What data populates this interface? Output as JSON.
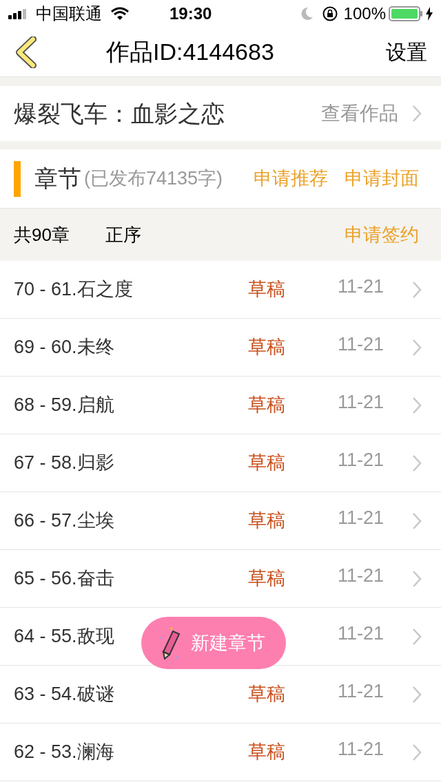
{
  "status_bar": {
    "carrier": "中国联通",
    "time": "19:30",
    "battery": "100%"
  },
  "nav": {
    "title": "作品ID:4144683",
    "action": "设置"
  },
  "book": {
    "title": "爆裂飞车：血影之恋",
    "link": "查看作品"
  },
  "chapters_header": {
    "title": "章节",
    "published": "(已发布74135字)",
    "actions": [
      "申请推荐",
      "申请封面"
    ]
  },
  "summary": {
    "count": "共90章",
    "sort": "正序",
    "action": "申请签约"
  },
  "chapters": [
    {
      "title": "70 - 61.石之度",
      "status": "草稿",
      "date": "11-21"
    },
    {
      "title": "69 - 60.未终",
      "status": "草稿",
      "date": "11-21"
    },
    {
      "title": "68 - 59.启航",
      "status": "草稿",
      "date": "11-21"
    },
    {
      "title": "67 - 58.归影",
      "status": "草稿",
      "date": "11-21"
    },
    {
      "title": "66 - 57.尘埃",
      "status": "草稿",
      "date": "11-21"
    },
    {
      "title": "65 - 56.奋击",
      "status": "草稿",
      "date": "11-21"
    },
    {
      "title": "64 - 55.敌现",
      "date": "11-21"
    },
    {
      "title": "63 - 54.破谜",
      "status": "草稿",
      "date": "11-21"
    },
    {
      "title": "62 - 53.澜海",
      "status": "草稿",
      "date": "11-21"
    }
  ],
  "fab": {
    "label": "新建章节"
  }
}
